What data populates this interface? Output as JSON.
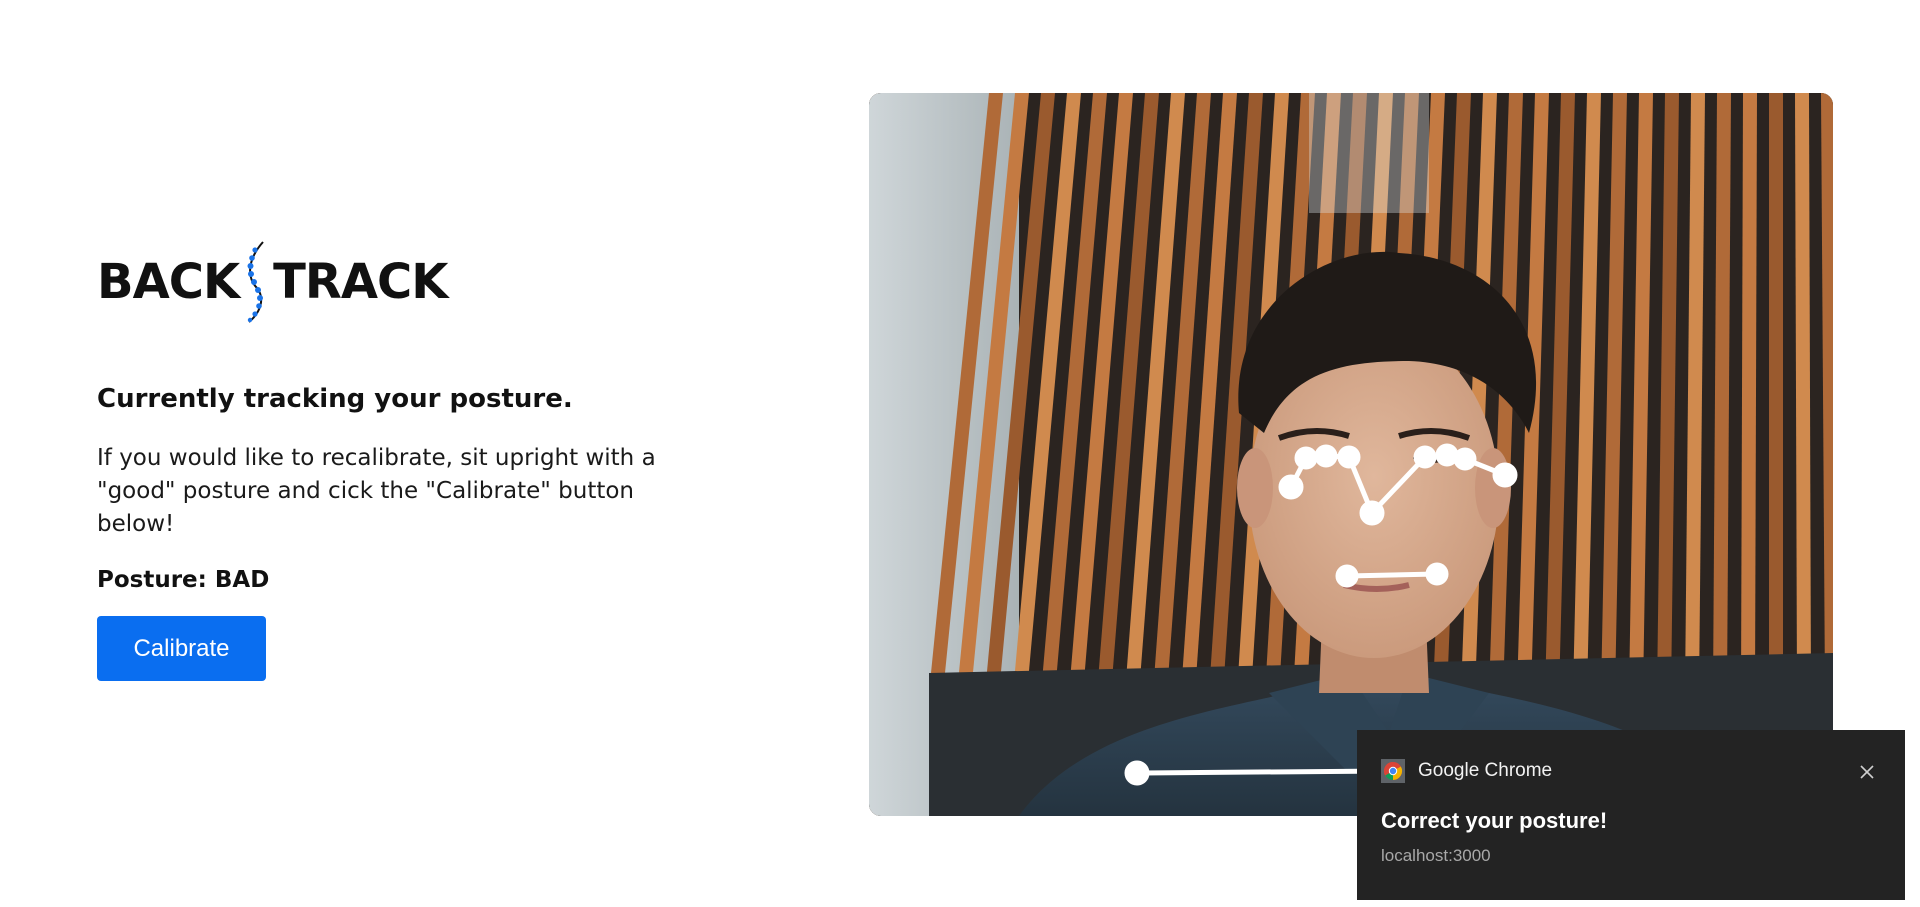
{
  "logo": {
    "left_text": "BACK",
    "right_text": "TRACK",
    "accent_color": "#1a73e8"
  },
  "tracking": {
    "heading": "Currently tracking your posture.",
    "instructions": "If you would like to recalibrate, sit upright with a \"good\" posture and cick the \"Calibrate\" button below!",
    "status_label": "Posture:",
    "status_value": "BAD"
  },
  "calibrate_button": {
    "label": "Calibrate",
    "color": "#0a6ef0"
  },
  "notification": {
    "app_name": "Google Chrome",
    "title": "Correct your posture!",
    "source": "localhost:3000",
    "icon": "chrome-icon",
    "close_icon": "close-icon",
    "background": "#232323"
  }
}
